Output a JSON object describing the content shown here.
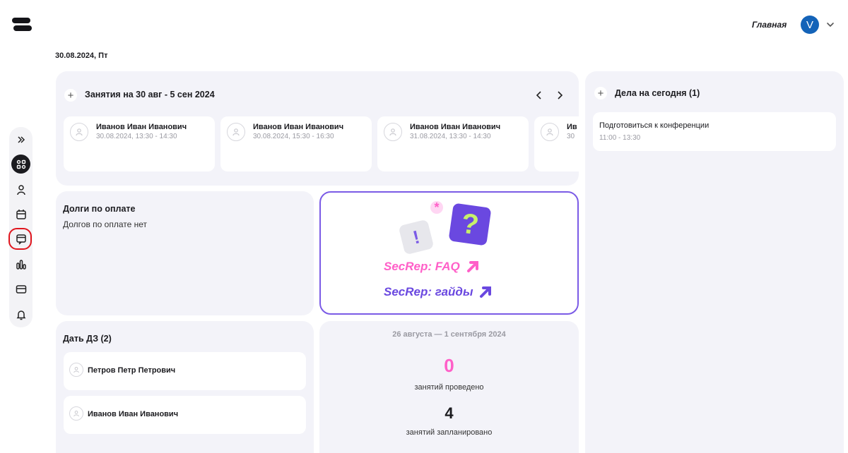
{
  "header": {
    "home_link": "Главная",
    "avatar_letter": "V"
  },
  "date": "30.08.2024, Пт",
  "lessons": {
    "title": "Занятия на 30 авг - 5 сен 2024",
    "items": [
      {
        "name": "Иванов Иван Иванович",
        "time": "30.08.2024, 13:30 - 14:30"
      },
      {
        "name": "Иванов Иван Иванович",
        "time": "30.08.2024, 15:30 - 16:30"
      },
      {
        "name": "Иванов Иван Иванович",
        "time": "31.08.2024, 13:30 - 14:30"
      },
      {
        "name": "Ив",
        "time": "30"
      }
    ]
  },
  "debts": {
    "title": "Долги по оплате",
    "empty_text": "Долгов по оплате нет"
  },
  "promo": {
    "faq_label": "SecRep: FAQ",
    "guides_label": "SecRep: гайды"
  },
  "homework": {
    "title": "Дать ДЗ (2)",
    "students": [
      "Петров Петр Петрович",
      "Иванов Иван Иванович"
    ]
  },
  "stats": {
    "period": "26 августа — 1 сентября 2024",
    "done_value": "0",
    "done_label": "занятий проведено",
    "planned_value": "4",
    "planned_label": "занятий запланировано"
  },
  "todos": {
    "title": "Дела на сегодня (1)",
    "items": [
      {
        "title": "Подготовиться к конференции",
        "time": "11:00 - 13:30"
      }
    ]
  },
  "colors": {
    "accent_pink": "#ff5fc8",
    "accent_purple": "#6a48e0",
    "avatar_blue": "#1463b8",
    "highlight_red": "#e0151d"
  }
}
